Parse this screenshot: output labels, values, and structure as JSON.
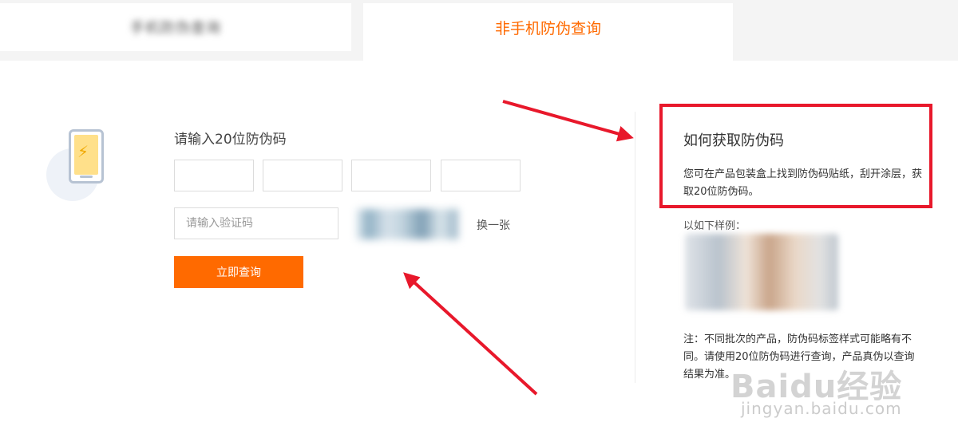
{
  "tabs": [
    {
      "label": "手机防伪查询",
      "active": false
    },
    {
      "label": "非手机防伪查询",
      "active": true
    }
  ],
  "form": {
    "title": "请输入20位防伪码",
    "captcha_placeholder": "请输入验证码",
    "refresh_label": "换一张",
    "submit_label": "立即查询"
  },
  "help": {
    "title": "如何获取防伪码",
    "description": "您可在产品包装盒上找到防伪码贴纸，刮开涂层，获取20位防伪码。",
    "example_label": "以如下样例：",
    "note": "注：不同批次的产品，防伪码标签样式可能略有不同。请使用20位防伪码进行查询，产品真伪以查询结果为准。"
  },
  "watermark": {
    "brand": "Baidu经验",
    "url": "jingyan.baidu.com"
  },
  "colors": {
    "accent": "#ff6a00",
    "highlight": "#e8182b"
  }
}
